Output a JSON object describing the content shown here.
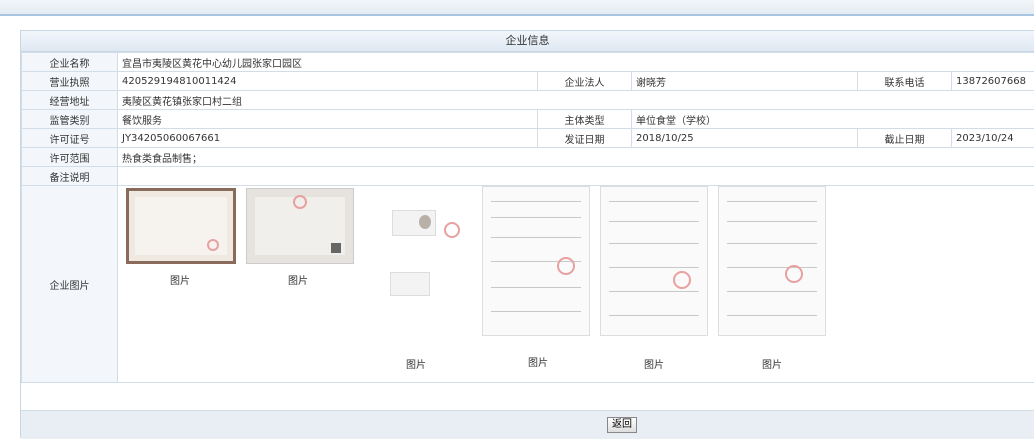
{
  "panel": {
    "title": "企业信息"
  },
  "rows": {
    "name": {
      "label": "企业名称",
      "value": "宜昌市夷陵区黄花中心幼儿园张家口园区"
    },
    "license": {
      "label": "营业执照",
      "value": "420529194810011424",
      "rep_label": "企业法人",
      "rep_value": "谢晓芳",
      "phone_label": "联系电话",
      "phone_value": "13872607668"
    },
    "address": {
      "label": "经营地址",
      "value": "夷陵区黄花镇张家口村二组"
    },
    "supervision": {
      "label": "监管类别",
      "value": "餐饮服务",
      "subject_label": "主体类型",
      "subject_value": "单位食堂（学校）"
    },
    "permit": {
      "label": "许可证号",
      "value": "JY34205060067661",
      "issue_label": "发证日期",
      "issue_value": "2018/10/25",
      "expire_label": "截止日期",
      "expire_value": "2023/10/24"
    },
    "scope": {
      "label": "许可范围",
      "value": "热食类食品制售；"
    },
    "remark": {
      "label": "备注说明",
      "value": ""
    },
    "photos": {
      "label": "企业图片",
      "captions": [
        "图片",
        "图片",
        "图片",
        "图片",
        "图片",
        "图片"
      ]
    }
  },
  "footer": {
    "back_label": "返回"
  }
}
